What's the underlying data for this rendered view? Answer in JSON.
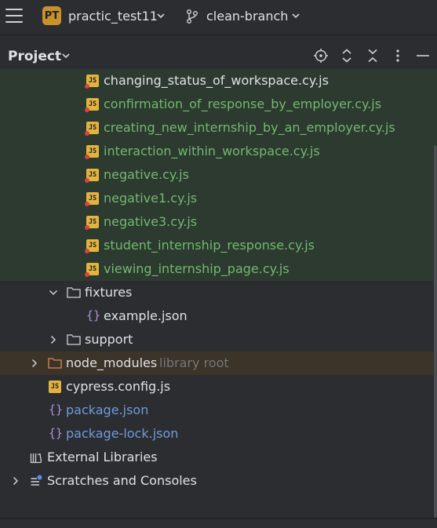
{
  "topbar": {
    "project_badge": "PT",
    "project_name": "practic_test11",
    "branch_name": "clean-branch"
  },
  "toolwindow": {
    "title": "Project"
  },
  "tree": {
    "cypress_files": [
      "changing_status_of_workspace.cy.js",
      "confirmation_of_response_by_employer.cy.js",
      "creating_new_internship_by_an_employer.cy.js",
      "interaction_within_workspace.cy.js",
      "negative.cy.js",
      "negative1.cy.js",
      "negative3.cy.js",
      "student_internship_response.cy.js",
      "viewing_internship_page.cy.js"
    ],
    "fixtures_folder": "fixtures",
    "fixtures_file": "example.json",
    "support_folder": "support",
    "node_modules": "node_modules",
    "node_modules_hint": "library root",
    "cypress_config": "cypress.config.js",
    "package_json": "package.json",
    "package_lock": "package-lock.json",
    "external_libraries": "External Libraries",
    "scratches": "Scratches and Consoles"
  },
  "icons": {
    "js_label": "JS",
    "json_label": "{}"
  },
  "colors": {
    "added_file": "#73b86f",
    "modified_file": "#6f9bdd",
    "excluded_hint": "#74777d"
  }
}
